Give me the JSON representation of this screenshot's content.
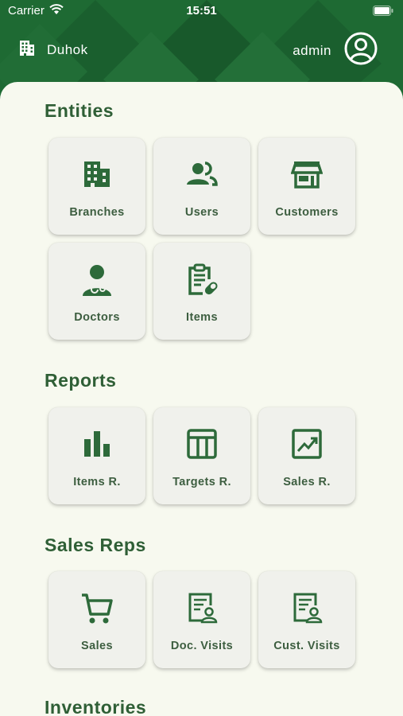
{
  "status_bar": {
    "carrier": "Carrier",
    "time": "15:51"
  },
  "header": {
    "branch": "Duhok",
    "username": "admin"
  },
  "colors": {
    "primary": "#1e6a33",
    "background": "#f7f9ef",
    "tile": "#f0f1ec",
    "icon": "#2d6a3a",
    "text": "#3d5e40"
  },
  "sections": {
    "entities": {
      "title": "Entities",
      "items": [
        {
          "label": "Branches",
          "icon": "building-icon"
        },
        {
          "label": "Users",
          "icon": "users-icon"
        },
        {
          "label": "Customers",
          "icon": "store-icon"
        },
        {
          "label": "Doctors",
          "icon": "doctor-icon"
        },
        {
          "label": "Items",
          "icon": "clipboard-pill-icon"
        }
      ]
    },
    "reports": {
      "title": "Reports",
      "items": [
        {
          "label": "Items R.",
          "icon": "bar-chart-icon"
        },
        {
          "label": "Targets R.",
          "icon": "table-icon"
        },
        {
          "label": "Sales R.",
          "icon": "trending-chart-icon"
        }
      ]
    },
    "sales_reps": {
      "title": "Sales Reps",
      "items": [
        {
          "label": "Sales",
          "icon": "cart-icon"
        },
        {
          "label": "Doc. Visits",
          "icon": "visit-report-icon"
        },
        {
          "label": "Cust. Visits",
          "icon": "visit-report-icon"
        }
      ]
    },
    "inventories": {
      "title": "Inventories"
    }
  }
}
